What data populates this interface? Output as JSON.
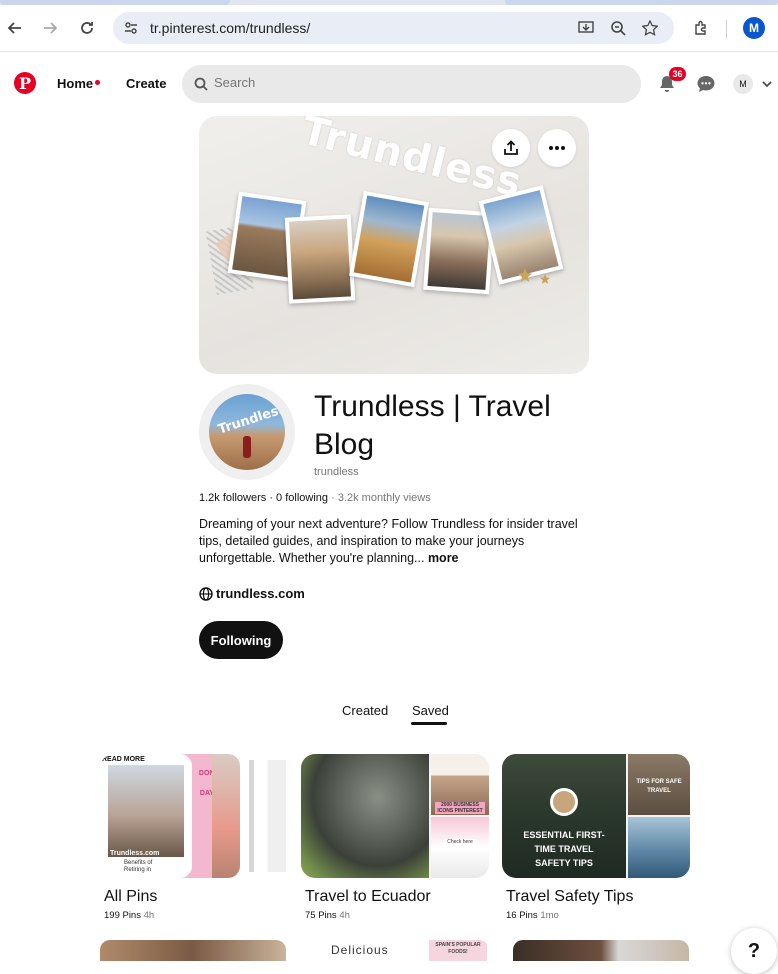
{
  "browser": {
    "url": "tr.pinterest.com/trundless/",
    "profile_initial": "M"
  },
  "header": {
    "logo": "P",
    "home_label": "Home",
    "create_label": "Create",
    "search_placeholder": "Search",
    "notifications_count": "36",
    "account_initial": "M"
  },
  "cover": {
    "title": "Trundless"
  },
  "profile": {
    "name": "Trundless | Travel Blog",
    "username": "trundless",
    "followers": "1.2k followers",
    "following": "0 following",
    "monthly_views": "3.2k monthly views",
    "bio": "Dreaming of your next adventure? Follow Trundless for insider travel tips, detailed guides, and inspiration to make your journeys unforgettable. Whether you're planning...",
    "bio_more": "more",
    "website": "trundless.com",
    "follow_button": "Following",
    "avatar_text": "Trundless"
  },
  "tabs": [
    {
      "label": "Created",
      "active": false
    },
    {
      "label": "Saved",
      "active": true
    }
  ],
  "boards": [
    {
      "name": "All Pins",
      "pins": "199 Pins",
      "time": "4h",
      "tiles": [
        "READ MORE",
        "Trundless.com",
        "Benefits of Retiring in",
        "DON S",
        "DAY"
      ]
    },
    {
      "name": "Travel to Ecuador",
      "pins": "75 Pins",
      "time": "4h",
      "tiles": [
        "2000 BUSINESS ICONS PINTEREST",
        "Check here"
      ]
    },
    {
      "name": "Travel Safety Tips",
      "pins": "16 Pins",
      "time": "1mo",
      "tiles": [
        "ESSENTIAL FIRST-TIME TRAVEL SAFETY TIPS",
        "TIPS FOR SAFE TRAVEL"
      ]
    }
  ],
  "row2": {
    "delicious": "Delicious",
    "spain": "SPAIN'S POPULAR FOODS!"
  },
  "help_label": "?"
}
